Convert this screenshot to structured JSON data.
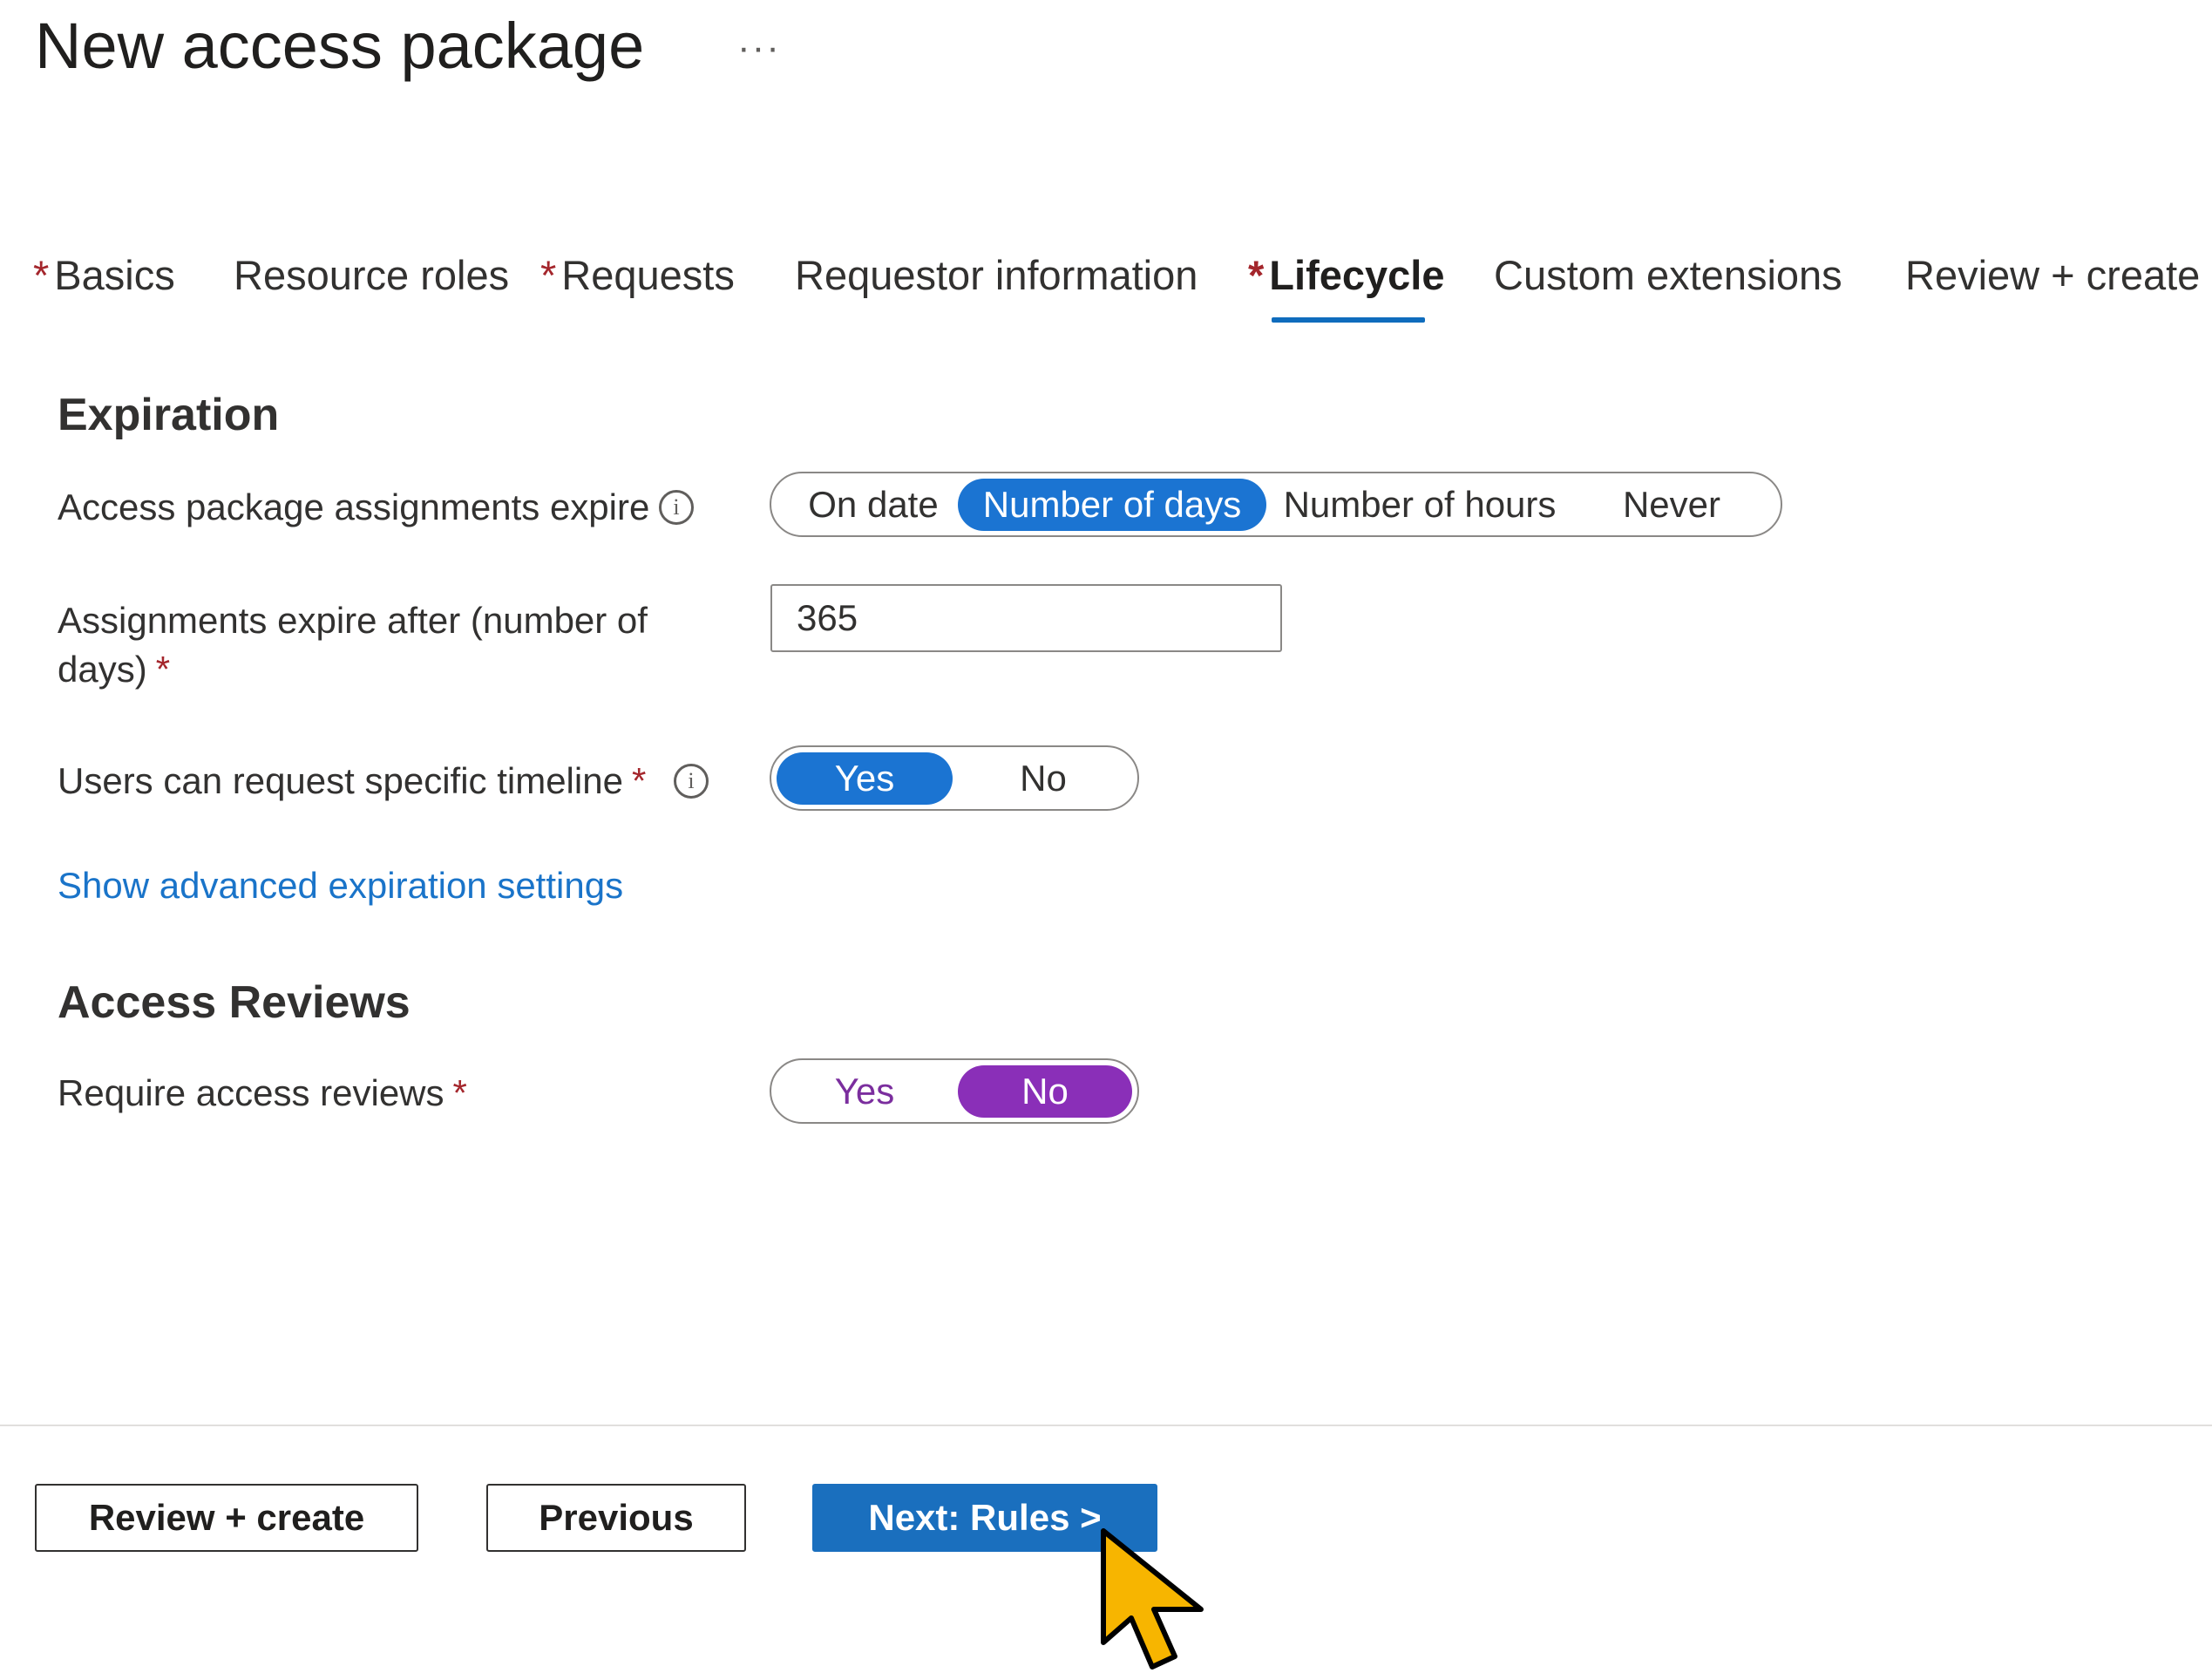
{
  "header": {
    "title": "New access package",
    "more_label": "···"
  },
  "tabs": [
    {
      "label": "Basics",
      "required": "*"
    },
    {
      "label": "Resource roles",
      "required": ""
    },
    {
      "label": "Requests",
      "required": "*"
    },
    {
      "label": "Requestor information",
      "required": ""
    },
    {
      "label": "Lifecycle",
      "required": "*",
      "active": true
    },
    {
      "label": "Custom extensions",
      "required": ""
    },
    {
      "label": "Review + create",
      "required": ""
    }
  ],
  "expiration": {
    "section_title": "Expiration",
    "expire_label": "Access package assignments expire",
    "expire_options": [
      "On date",
      "Number of days",
      "Number of hours",
      "Never"
    ],
    "expire_selected": "Number of days",
    "days_label_line1": "Assignments expire after (number of",
    "days_label_line2": "days)",
    "days_value": "365",
    "timeline_label": "Users can request specific timeline",
    "timeline_options": [
      "Yes",
      "No"
    ],
    "timeline_selected": "Yes",
    "advanced_link": "Show advanced expiration settings",
    "required_mark": "*"
  },
  "access_reviews": {
    "section_title": "Access Reviews",
    "require_label": "Require access reviews",
    "options": [
      "Yes",
      "No"
    ],
    "selected": "No",
    "required_mark": "*"
  },
  "info_glyph": "i",
  "footer": {
    "review_create": "Review + create",
    "previous": "Previous",
    "next": "Next: Rules >"
  },
  "colors": {
    "accent_blue": "#1b74d2",
    "accent_purple": "#8a2fb8",
    "required_red": "#a4262c",
    "cursor_yellow": "#f7b500"
  },
  "icons": {
    "more": "ellipsis-icon",
    "info": "info-icon",
    "pointer": "mouse-pointer-icon"
  }
}
